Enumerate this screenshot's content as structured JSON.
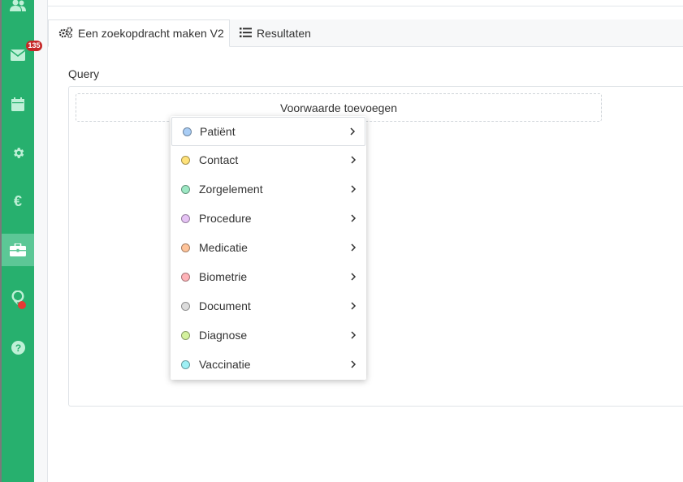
{
  "sidebar": {
    "items": [
      {
        "icon": "users-icon"
      },
      {
        "icon": "mail-icon",
        "badge": "135"
      },
      {
        "icon": "calendar-icon"
      },
      {
        "icon": "gear-icon"
      },
      {
        "icon": "euro-icon",
        "glyph": "€"
      },
      {
        "icon": "briefcase-icon",
        "active": true
      },
      {
        "icon": "location-pin-icon",
        "indicator": "red"
      },
      {
        "icon": "help-icon"
      }
    ]
  },
  "tabs": [
    {
      "label": "Een zoekopdracht maken V2",
      "icon": "gears-icon",
      "active": true
    },
    {
      "label": "Resultaten",
      "icon": "list-icon",
      "active": false
    }
  ],
  "query": {
    "label": "Query",
    "add_condition_label": "Voorwaarde toevoegen"
  },
  "dropdown": {
    "items": [
      {
        "label": "Patiënt",
        "color": "#a9cdf5"
      },
      {
        "label": "Contact",
        "color": "#ffe27a"
      },
      {
        "label": "Zorgelement",
        "color": "#9de8c4"
      },
      {
        "label": "Procedure",
        "color": "#e6c3f5"
      },
      {
        "label": "Medicatie",
        "color": "#ffc49a"
      },
      {
        "label": "Biometrie",
        "color": "#ffb3b8"
      },
      {
        "label": "Document",
        "color": "#dcdcdc"
      },
      {
        "label": "Diagnose",
        "color": "#d4f29e"
      },
      {
        "label": "Vaccinatie",
        "color": "#9ef0f5"
      }
    ]
  },
  "colors": {
    "brand": "#27b06e",
    "active_nav": "#5cc796",
    "badge": "#c62828"
  }
}
